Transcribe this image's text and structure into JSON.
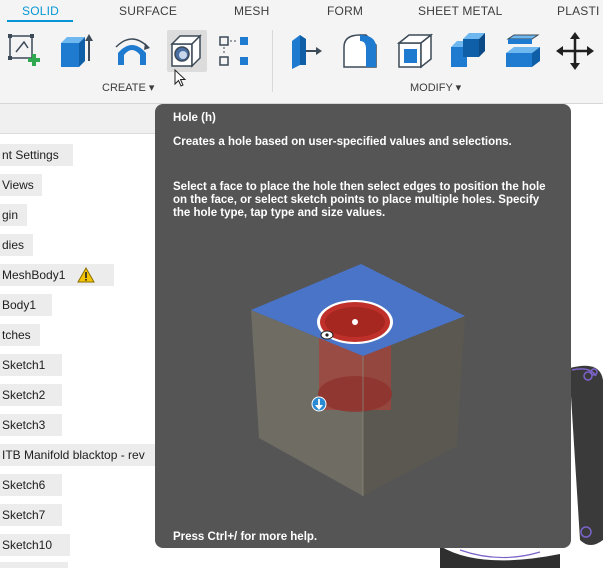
{
  "ribbon": {
    "tabs": [
      {
        "label": "SOLID",
        "active": true
      },
      {
        "label": "SURFACE",
        "active": false
      },
      {
        "label": "MESH",
        "active": false
      },
      {
        "label": "FORM",
        "active": false
      },
      {
        "label": "SHEET METAL",
        "active": false
      },
      {
        "label": "PLASTI",
        "active": false
      }
    ],
    "create_group_label": "CREATE ▾",
    "modify_group_label": "MODIFY ▾",
    "create_tools": [
      "create-sketch-icon",
      "extrude-icon",
      "revolve-icon",
      "hole-icon",
      "pattern-icon"
    ],
    "modify_tools": [
      "press-pull-icon",
      "fillet-icon",
      "shell-icon",
      "combine-icon",
      "replace-face-icon",
      "move-icon"
    ],
    "accent_color": "#0696d7"
  },
  "browser": {
    "nodes": [
      {
        "label": "nt Settings"
      },
      {
        "label": "Views"
      },
      {
        "label": "gin"
      },
      {
        "label": "dies"
      },
      {
        "label": "MeshBody1",
        "warning": true
      },
      {
        "label": "Body1"
      },
      {
        "label": "tches"
      },
      {
        "label": "Sketch1"
      },
      {
        "label": "Sketch2"
      },
      {
        "label": "Sketch3"
      },
      {
        "label": "ITB Manifold blacktop - rev"
      },
      {
        "label": "Sketch6"
      },
      {
        "label": "Sketch7"
      },
      {
        "label": "Sketch10"
      }
    ]
  },
  "tooltip": {
    "title": "Hole (h)",
    "paragraph1": "Creates a hole based on user-specified values and selections.",
    "paragraph2": "Select a face to place the hole then select edges to position the hole on the face, or select sketch points to place multiple holes. Specify the hole type, tap type and size values.",
    "footer": "Press Ctrl+/ for more help."
  }
}
